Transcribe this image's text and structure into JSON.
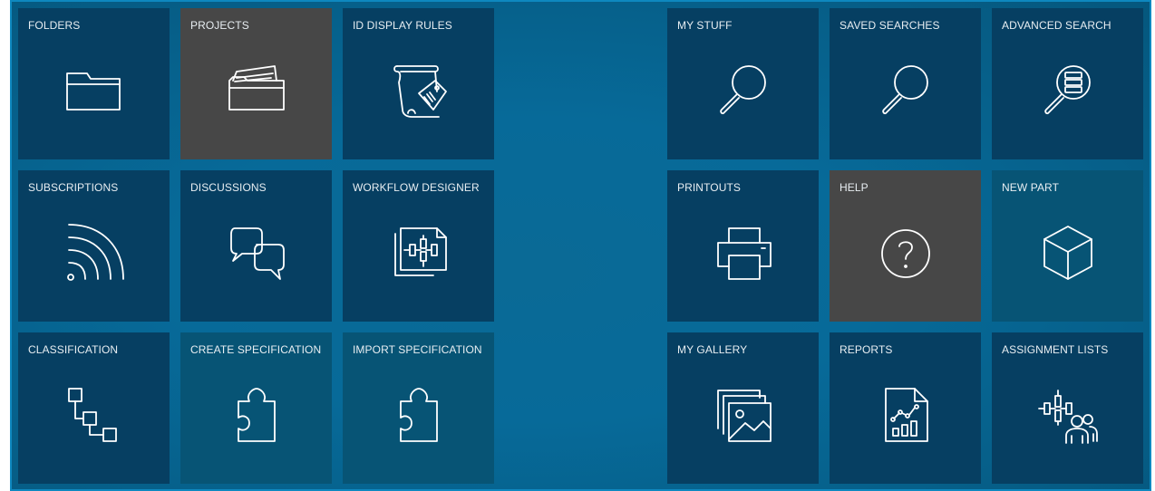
{
  "tiles": {
    "folders": {
      "label": "FOLDERS",
      "icon": "folder-icon"
    },
    "projects": {
      "label": "PROJECTS",
      "icon": "projects-icon"
    },
    "id_display_rules": {
      "label": "ID DISPLAY RULES",
      "icon": "scroll-tag-icon"
    },
    "my_stuff": {
      "label": "MY STUFF",
      "icon": "search-icon"
    },
    "saved_searches": {
      "label": "SAVED SEARCHES",
      "icon": "search-icon"
    },
    "advanced_search": {
      "label": "ADVANCED SEARCH",
      "icon": "advanced-search-icon"
    },
    "subscriptions": {
      "label": "SUBSCRIPTIONS",
      "icon": "rss-icon"
    },
    "discussions": {
      "label": "DISCUSSIONS",
      "icon": "chat-bubbles-icon"
    },
    "workflow_designer": {
      "label": "WORKFLOW DESIGNER",
      "icon": "workflow-icon"
    },
    "printouts": {
      "label": "PRINTOUTS",
      "icon": "printer-icon"
    },
    "help": {
      "label": "HELP",
      "icon": "help-icon"
    },
    "new_part": {
      "label": "NEW PART",
      "icon": "cube-icon"
    },
    "classification": {
      "label": "CLASSIFICATION",
      "icon": "hierarchy-icon"
    },
    "create_specification": {
      "label": "CREATE SPECIFICATION",
      "icon": "puzzle-icon"
    },
    "import_specification": {
      "label": "IMPORT SPECIFICATION",
      "icon": "puzzle-icon"
    },
    "my_gallery": {
      "label": "MY GALLERY",
      "icon": "gallery-icon"
    },
    "reports": {
      "label": "REPORTS",
      "icon": "report-chart-icon"
    },
    "assignment_lists": {
      "label": "ASSIGNMENT LISTS",
      "icon": "assignment-people-icon"
    }
  },
  "colors": {
    "tile": "#063f62",
    "tile_highlight": "#474747",
    "background": "#076a99",
    "border": "#0e88bf",
    "text": "#e8eef2"
  }
}
